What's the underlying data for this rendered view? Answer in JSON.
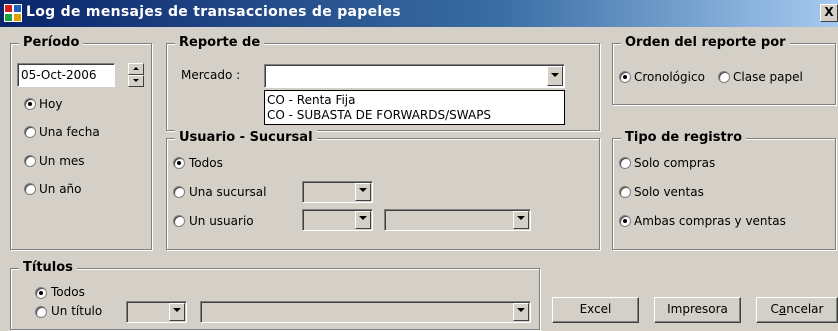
{
  "window": {
    "title": "Log de mensajes de transacciones de papeles",
    "close_label": "X"
  },
  "periodo": {
    "legend": "Período",
    "date_value": "05-Oct-2006",
    "options": [
      {
        "label": "Hoy",
        "selected": true
      },
      {
        "label": "Una fecha",
        "selected": false
      },
      {
        "label": "Un mes",
        "selected": false
      },
      {
        "label": "Un año",
        "selected": false
      }
    ]
  },
  "reporte": {
    "legend": "Reporte de",
    "mercado_label": "Mercado :",
    "mercado_value": "",
    "mercado_options": [
      "CO - Renta Fija",
      "CO - SUBASTA DE FORWARDS/SWAPS"
    ]
  },
  "orden": {
    "legend": "Orden del reporte por",
    "options": [
      {
        "label": "Cronológico",
        "selected": true
      },
      {
        "label": "Clase papel",
        "selected": false
      }
    ]
  },
  "usuario": {
    "legend": "Usuario - Sucursal",
    "options": [
      {
        "label": "Todos",
        "selected": true
      },
      {
        "label": "Una sucursal",
        "selected": false
      },
      {
        "label": "Un usuario",
        "selected": false
      }
    ]
  },
  "tipo": {
    "legend": "Tipo de registro",
    "options": [
      {
        "label": "Solo compras",
        "selected": false
      },
      {
        "label": "Solo ventas",
        "selected": false
      },
      {
        "label": "Ambas compras y ventas",
        "selected": true
      }
    ]
  },
  "titulos": {
    "legend": "Títulos",
    "options": [
      {
        "label": "Todos",
        "selected": true
      },
      {
        "label": "Un título",
        "selected": false
      }
    ]
  },
  "buttons": {
    "excel": "Excel",
    "impresora": "Impresora",
    "cancelar_pre": "C",
    "cancelar_ul": "a",
    "cancelar_post": "ncelar"
  }
}
